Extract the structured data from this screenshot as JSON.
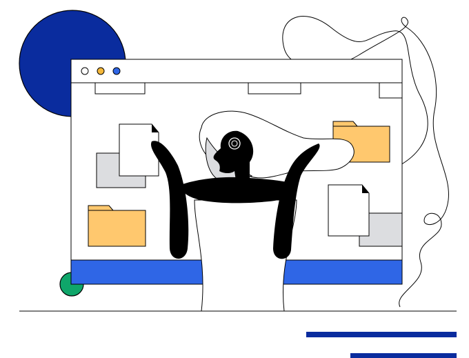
{
  "colors": {
    "navy": "#0a2c9e",
    "blue": "#2f66e6",
    "green": "#0fa66a",
    "folder": "#ffc86e",
    "gray": "#dcdde0",
    "ink": "#000000",
    "paper": "#ffffff",
    "dot_yellow": "#f5b83a",
    "dot_blue": "#2f66e6"
  },
  "window": {
    "controls": [
      "close-dot-icon",
      "minimize-dot-icon",
      "maximize-dot-icon"
    ]
  },
  "icons": [
    "folder-icon",
    "document-icon",
    "person-juggling-files-illustration"
  ]
}
